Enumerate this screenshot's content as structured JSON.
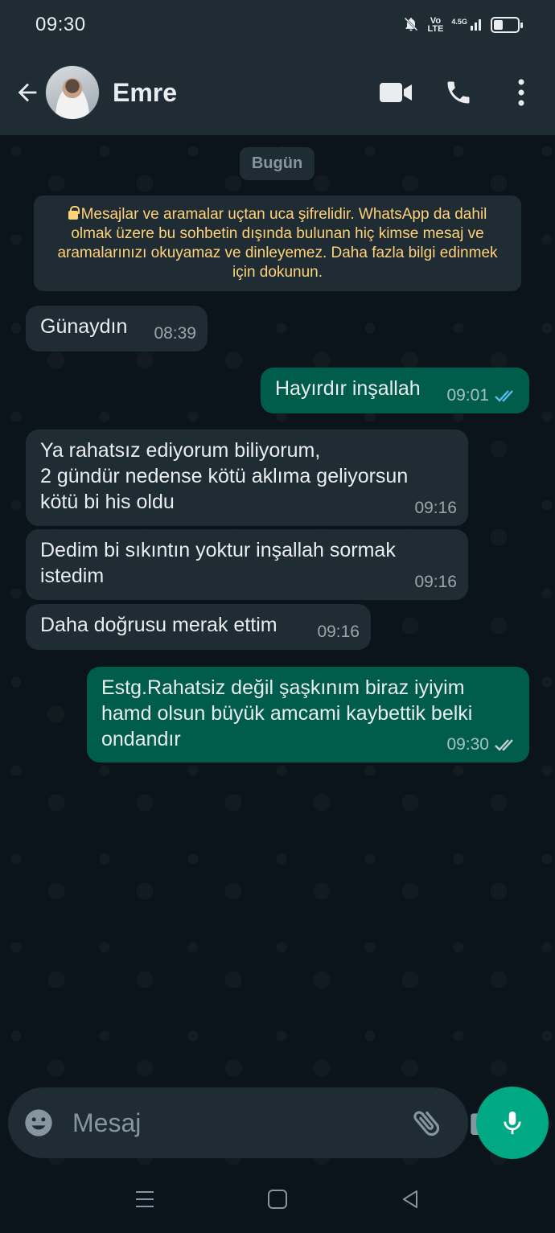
{
  "status_bar": {
    "time": "09:30",
    "network": "Vo\nLTE",
    "signal_label": "4.5G"
  },
  "header": {
    "contact_name": "Emre"
  },
  "chat": {
    "date_chip": "Bugün",
    "encryption_notice": "Mesajlar ve aramalar uçtan uca şifrelidir. WhatsApp da dahil olmak üzere bu sohbetin dışında bulunan hiç kimse mesaj ve aramalarınızı okuyamaz ve dinleyemez. Daha fazla bilgi edinmek için dokunun.",
    "messages": [
      {
        "direction": "in",
        "text": "Günaydın",
        "time": "08:39"
      },
      {
        "direction": "out",
        "text": "Hayırdır inşallah",
        "time": "09:01",
        "status": "read"
      },
      {
        "direction": "in",
        "text": "Ya rahatsız ediyorum biliyorum,\n2 gündür nedense kötü aklıma geliyorsun\nkötü bi his oldu",
        "time": "09:16"
      },
      {
        "direction": "in",
        "text": "Dedim bi sıkıntın yoktur inşallah sormak\nistedim",
        "time": "09:16"
      },
      {
        "direction": "in",
        "text": "Daha doğrusu merak ettim",
        "time": "09:16"
      },
      {
        "direction": "out",
        "text": "Estg.Rahatsiz değil şaşkınım biraz iyiyim\nhamd olsun büyük amcami kaybettik belki\nondandır",
        "time": "09:30",
        "status": "delivered"
      }
    ]
  },
  "composer": {
    "placeholder": "Mesaj"
  },
  "colors": {
    "background": "#0b141a",
    "panel": "#1f2c34",
    "outgoing_bubble": "#005c4b",
    "accent": "#00a884",
    "read_ticks": "#53bdeb",
    "notice_text": "#ffd279"
  },
  "icons": [
    "back-arrow-icon",
    "video-call-icon",
    "phone-icon",
    "more-options-icon",
    "lock-icon",
    "emoji-icon",
    "attach-icon",
    "camera-icon",
    "mic-icon"
  ]
}
